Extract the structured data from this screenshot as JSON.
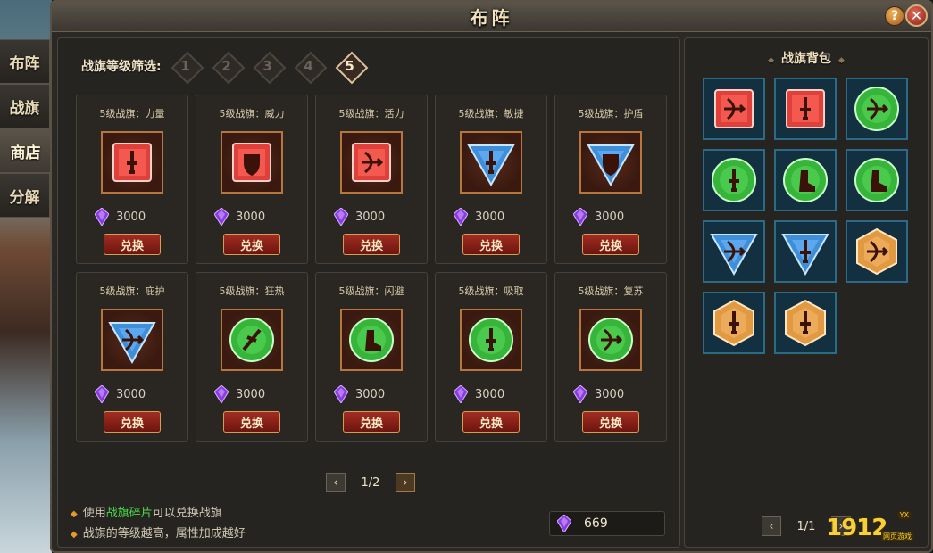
{
  "window": {
    "title": "布阵",
    "help": "?",
    "close": "✕"
  },
  "side_tabs": [
    {
      "label": "布阵"
    },
    {
      "label": "战旗"
    },
    {
      "label": "商店"
    },
    {
      "label": "分解"
    }
  ],
  "filter": {
    "label": "战旗等级筛选:",
    "levels": [
      "1",
      "2",
      "3",
      "4",
      "5"
    ],
    "selected": "5"
  },
  "shop_items": [
    {
      "name": "5级战旗：力量",
      "color": "red",
      "shape": "square",
      "symbol": "sword",
      "price": "3000",
      "button": "兑换"
    },
    {
      "name": "5级战旗：威力",
      "color": "red",
      "shape": "square",
      "symbol": "shield",
      "price": "3000",
      "button": "兑换"
    },
    {
      "name": "5级战旗：活力",
      "color": "red",
      "shape": "square",
      "symbol": "bow",
      "price": "3000",
      "button": "兑换"
    },
    {
      "name": "5级战旗：敏捷",
      "color": "blue",
      "shape": "triangle",
      "symbol": "sword",
      "price": "3000",
      "button": "兑换"
    },
    {
      "name": "5级战旗：护盾",
      "color": "blue",
      "shape": "triangle",
      "symbol": "shield",
      "price": "3000",
      "button": "兑换"
    },
    {
      "name": "5级战旗：庇护",
      "color": "blue",
      "shape": "triangle",
      "symbol": "bow",
      "price": "3000",
      "button": "兑换"
    },
    {
      "name": "5级战旗：狂热",
      "color": "green",
      "shape": "round",
      "symbol": "slash",
      "price": "3000",
      "button": "兑换"
    },
    {
      "name": "5级战旗：闪避",
      "color": "green",
      "shape": "round",
      "symbol": "boot",
      "price": "3000",
      "button": "兑换"
    },
    {
      "name": "5级战旗：吸取",
      "color": "green",
      "shape": "round",
      "symbol": "sword",
      "price": "3000",
      "button": "兑换"
    },
    {
      "name": "5级战旗：复苏",
      "color": "green",
      "shape": "round",
      "symbol": "bow",
      "price": "3000",
      "button": "兑换"
    }
  ],
  "shop_pager": {
    "prev": "‹",
    "text": "1/2",
    "next": "›"
  },
  "tips": {
    "line1_pre": "使用",
    "line1_highlight": "战旗碎片",
    "line1_post": "可以兑换战旗",
    "line2": "战旗的等级越高，属性加成越好"
  },
  "currency": {
    "value": "669"
  },
  "bag": {
    "title": "战旗背包",
    "items": [
      {
        "color": "red",
        "shape": "square",
        "symbol": "bow"
      },
      {
        "color": "red",
        "shape": "square",
        "symbol": "sword"
      },
      {
        "color": "green",
        "shape": "round",
        "symbol": "bow"
      },
      {
        "color": "green",
        "shape": "round",
        "symbol": "sword"
      },
      {
        "color": "green",
        "shape": "round",
        "symbol": "boot"
      },
      {
        "color": "green",
        "shape": "round",
        "symbol": "boot"
      },
      {
        "color": "blue",
        "shape": "triangle",
        "symbol": "bow"
      },
      {
        "color": "blue",
        "shape": "triangle",
        "symbol": "sword"
      },
      {
        "color": "orange",
        "shape": "hex",
        "symbol": "bow"
      },
      {
        "color": "orange",
        "shape": "hex",
        "symbol": "sword"
      },
      {
        "color": "orange",
        "shape": "hex",
        "symbol": "sword"
      }
    ],
    "pager": {
      "prev": "‹",
      "text": "1/1",
      "next": "›"
    }
  },
  "logo": {
    "text": "1912",
    "badge": "YX",
    "sub": "网页游戏"
  },
  "colors": {
    "red": "#e0403a",
    "blue": "#3f8fd8",
    "green": "#37b43a",
    "orange": "#e29a42"
  }
}
